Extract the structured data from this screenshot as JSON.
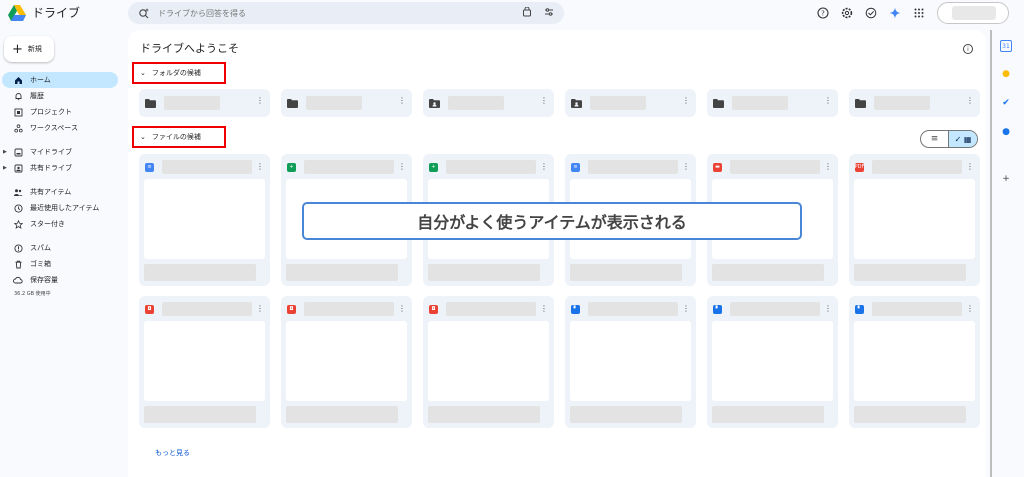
{
  "app": {
    "title": "ドライブ",
    "logo_colors": [
      "#0f9d58",
      "#fbbc04",
      "#4285f4"
    ]
  },
  "search": {
    "placeholder": "ドライブから回答を得る",
    "icon": "sparkle-search-icon",
    "right_icons": [
      "lock-search-icon",
      "filter-sliders-icon"
    ]
  },
  "header_icons": [
    "help-icon",
    "settings-icon",
    "offline-ready-icon",
    "gemini-icon",
    "apps-grid-icon"
  ],
  "sidebar": {
    "new_label": "新規",
    "items": [
      {
        "label": "ホーム",
        "icon": "home-icon",
        "active": true
      },
      {
        "label": "履歴",
        "icon": "bell-icon"
      },
      {
        "label": "プロジェクト",
        "icon": "project-icon"
      },
      {
        "label": "ワークスペース",
        "icon": "workspace-icon"
      },
      {
        "label": "マイドライブ",
        "icon": "my-drive-icon",
        "expandable": true
      },
      {
        "label": "共有ドライブ",
        "icon": "shared-drive-icon",
        "expandable": true
      },
      {
        "label": "共有アイテム",
        "icon": "people-icon"
      },
      {
        "label": "最近使用したアイテム",
        "icon": "clock-icon"
      },
      {
        "label": "スター付き",
        "icon": "star-icon"
      },
      {
        "label": "スパム",
        "icon": "spam-icon"
      },
      {
        "label": "ゴミ箱",
        "icon": "trash-icon"
      },
      {
        "label": "保存容量",
        "icon": "cloud-icon"
      }
    ],
    "storage_text": "36.2 GB 使用中"
  },
  "main": {
    "title": "ドライブへようこそ",
    "folder_section": "フォルダの候補",
    "file_section": "ファイルの候補",
    "folders": [
      {
        "icon": "folder-icon"
      },
      {
        "icon": "folder-icon"
      },
      {
        "icon": "shared-folder-icon"
      },
      {
        "icon": "shared-folder-icon"
      },
      {
        "icon": "folder-icon"
      },
      {
        "icon": "folder-icon"
      }
    ],
    "files": [
      {
        "type": "docs",
        "color": "#4285f4",
        "glyph": "≡"
      },
      {
        "type": "sheets",
        "color": "#0f9d58",
        "glyph": "+"
      },
      {
        "type": "sheets",
        "color": "#0f9d58",
        "glyph": "+"
      },
      {
        "type": "docs",
        "color": "#4285f4",
        "glyph": "≡"
      },
      {
        "type": "calendar",
        "color": "#ea4335",
        "glyph": "▬"
      },
      {
        "type": "pdf",
        "color": "#ea4335",
        "glyph": "PDF"
      },
      {
        "type": "zip",
        "color": "#ea4335",
        "glyph": "◘"
      },
      {
        "type": "zip",
        "color": "#ea4335",
        "glyph": "◘"
      },
      {
        "type": "zip",
        "color": "#ea4335",
        "glyph": "◘"
      },
      {
        "type": "file",
        "color": "#1a73e8",
        "glyph": "▘"
      },
      {
        "type": "file",
        "color": "#1a73e8",
        "glyph": "▘"
      },
      {
        "type": "file",
        "color": "#1a73e8",
        "glyph": "▘"
      }
    ],
    "more_label": "もっと見る",
    "callout": "自分がよく使うアイテムが表示される"
  },
  "view_toggle": {
    "list_icon": "list-view-icon",
    "grid_icon": "grid-view-icon",
    "selected": "grid"
  },
  "rail_icons": [
    {
      "name": "calendar-app-icon",
      "color": "#4285f4",
      "glyph": "31"
    },
    {
      "name": "keep-app-icon",
      "color": "#fbbc04",
      "glyph": "●"
    },
    {
      "name": "tasks-app-icon",
      "color": "#1a73e8",
      "glyph": "✔"
    },
    {
      "name": "contacts-app-icon",
      "color": "#1a73e8",
      "glyph": "●"
    },
    {
      "name": "add-addon-icon",
      "color": "#444444",
      "glyph": "+"
    }
  ]
}
